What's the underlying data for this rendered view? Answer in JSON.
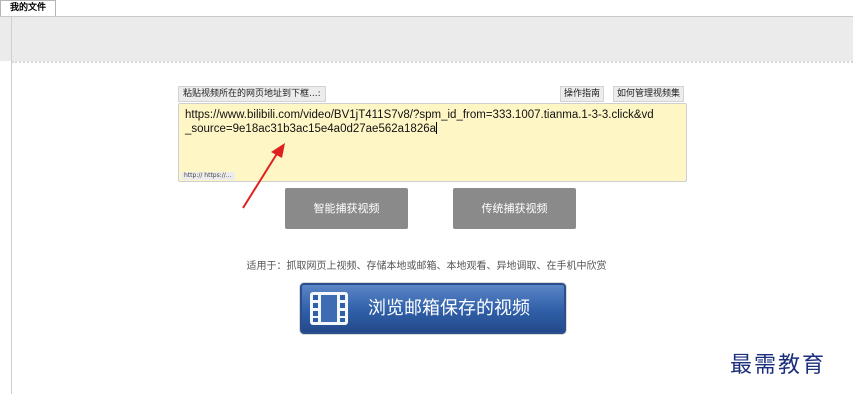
{
  "tabs": [
    {
      "label": "我的文件"
    }
  ],
  "capture": {
    "paste_label": "粘贴视频所在的网页地址到下框...:",
    "guide_button": "操作指南",
    "manage_button": "如何管理视频集",
    "url_value": "https://www.bilibili.com/video/BV1jT411S7v8/?spm_id_from=333.1007.tianma.1-3-3.click&vd_source=9e18ac31b3ac15e4a0d27ae562a1826a",
    "protocol_hint": "http:// https://...",
    "smart_button": "智能捕获视频",
    "classic_button": "传统捕获视频",
    "applies_text": "适用于：抓取网页上视频、存储本地或邮箱、本地观看、异地调取、在手机中欣赏",
    "browse_button": "浏览邮箱保存的视频"
  },
  "watermark": "最需教育",
  "colors": {
    "input_bg": "#fff6c6",
    "gray_button": "#8a8a8a",
    "browse_button": "#2f5fa8",
    "arrow": "#e02020",
    "watermark": "#1c2f7c"
  },
  "icons": {
    "browse_button_icon": "film-strip-icon",
    "annotation": "red-arrow-icon"
  }
}
